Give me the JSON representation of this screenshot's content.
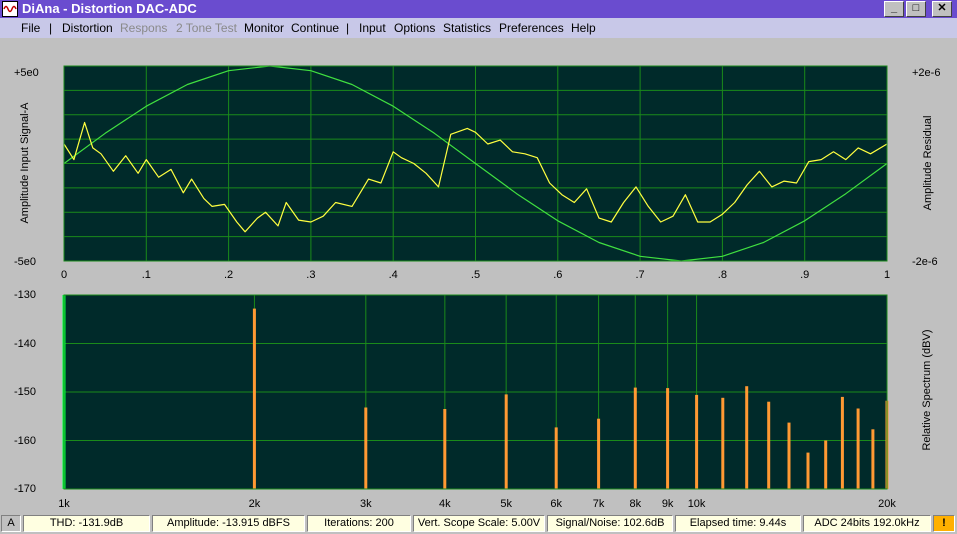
{
  "window": {
    "title": "DiAna - Distortion DAC-ADC"
  },
  "menu": {
    "file": "File",
    "sep1": "|",
    "distortion": "Distortion",
    "respons": "Respons",
    "two_tone": "2 Tone Test",
    "monitor": "Monitor",
    "continue": "Continue",
    "sep2": "|",
    "input": "Input",
    "options": "Options",
    "statistics": "Statistics",
    "preferences": "Preferences",
    "help": "Help"
  },
  "scope": {
    "left_top": "+5e0",
    "left_bottom": "-5e0",
    "right_top": "+2e-6",
    "right_bottom": "-2e-6",
    "left_label": "Amplitude Input Signal-A",
    "right_label": "Amplitude Residual",
    "x_ticks": [
      "0",
      ".1",
      ".2",
      ".3",
      ".4",
      ".5",
      ".6",
      ".7",
      ".8",
      ".9",
      "1"
    ]
  },
  "spectrum": {
    "y_ticks": [
      "-130",
      "-140",
      "-150",
      "-160",
      "-170"
    ],
    "x_ticks": [
      "1k",
      "2k",
      "3k",
      "4k",
      "5k",
      "6k",
      "7k",
      "8k",
      "9k",
      "10k",
      "20k"
    ],
    "right_label": "Relative Spectrum (dBV)"
  },
  "status": {
    "a": "A",
    "thd": "THD: -131.9dB",
    "amplitude": "Amplitude: -13.915 dBFS",
    "iterations": "Iterations: 200",
    "scale": "Vert. Scope Scale: 5.00V",
    "snr": "Signal/Noise:  102.6dB",
    "elapsed": "Elapsed time: 9.44s",
    "adc": "ADC 24bits 192.0kHz",
    "warn": "!"
  },
  "chart_data": [
    {
      "type": "line",
      "x_range": [
        0,
        1
      ],
      "left_ylim": [
        -5,
        5
      ],
      "right_ylim": [
        -2e-06,
        2e-06
      ],
      "grid": true,
      "series": [
        {
          "color": "#40e040",
          "x": [
            0,
            0.05,
            0.1,
            0.15,
            0.2,
            0.25,
            0.3,
            0.35,
            0.4,
            0.45,
            0.5,
            0.55,
            0.6,
            0.65,
            0.7,
            0.75,
            0.8,
            0.85,
            0.9,
            0.95,
            1.0
          ],
          "y": [
            0,
            1.55,
            2.94,
            4.05,
            4.76,
            5.0,
            4.76,
            4.05,
            2.94,
            1.55,
            0,
            -1.55,
            -2.94,
            -4.05,
            -4.76,
            -5.0,
            -4.76,
            -4.05,
            -2.94,
            -1.55,
            0
          ]
        },
        {
          "color": "#ffff40",
          "x": [
            0,
            0.012,
            0.025,
            0.035,
            0.045,
            0.06,
            0.075,
            0.09,
            0.1,
            0.115,
            0.13,
            0.145,
            0.155,
            0.17,
            0.18,
            0.195,
            0.21,
            0.22,
            0.235,
            0.245,
            0.26,
            0.27,
            0.285,
            0.3,
            0.315,
            0.33,
            0.35,
            0.37,
            0.385,
            0.4,
            0.41,
            0.425,
            0.44,
            0.455,
            0.47,
            0.49,
            0.5,
            0.515,
            0.53,
            0.545,
            0.56,
            0.575,
            0.59,
            0.605,
            0.62,
            0.635,
            0.65,
            0.665,
            0.68,
            0.695,
            0.71,
            0.725,
            0.74,
            0.755,
            0.77,
            0.785,
            0.8,
            0.815,
            0.83,
            0.845,
            0.86,
            0.875,
            0.89,
            0.905,
            0.92,
            0.935,
            0.95,
            0.965,
            0.98,
            1.0
          ],
          "y": [
            1.0,
            0.2,
            2.1,
            0.8,
            0.5,
            -0.4,
            0.4,
            -0.5,
            0.2,
            -0.7,
            -0.3,
            -1.5,
            -0.8,
            -1.8,
            -2.2,
            -2.1,
            -3.0,
            -3.5,
            -2.8,
            -2.5,
            -3.2,
            -2.0,
            -2.9,
            -3.0,
            -2.7,
            -2.0,
            -2.2,
            -0.8,
            -1.0,
            0.6,
            0.3,
            0.0,
            -0.5,
            -1.2,
            1.5,
            1.8,
            1.6,
            1.0,
            1.2,
            0.6,
            0.5,
            0.3,
            -1.0,
            -1.6,
            -2.0,
            -1.3,
            -2.8,
            -3.0,
            -2.0,
            -1.2,
            -2.2,
            -3.0,
            -2.7,
            -1.6,
            -3.0,
            -3.0,
            -2.6,
            -2.0,
            -1.1,
            -0.4,
            -1.2,
            -0.9,
            -1.0,
            0.1,
            0.2,
            0.6,
            0.2,
            0.8,
            0.5,
            1.0
          ]
        }
      ]
    },
    {
      "type": "bar",
      "x_scale": "log",
      "x_range": [
        1000,
        20000
      ],
      "ylim": [
        -170,
        -130
      ],
      "grid": true,
      "series": [
        {
          "color": "#ff9933",
          "x": [
            2000,
            3000,
            4000,
            5000,
            6000,
            7000,
            8000,
            9000,
            10000,
            11000,
            12000,
            13000,
            14000,
            15000,
            16000,
            17000,
            18000,
            19000,
            20000
          ],
          "values": [
            -132.8,
            -153.2,
            -153.5,
            -150.5,
            -157.3,
            -155.5,
            -149.1,
            -149.2,
            -150.6,
            -151.2,
            -148.8,
            -152.0,
            -156.3,
            -162.5,
            -160.0,
            -151.0,
            -153.4,
            -157.7,
            -151.8
          ]
        },
        {
          "color": "#00ff44",
          "x": [
            1000
          ],
          "values": [
            -130
          ]
        }
      ]
    }
  ]
}
